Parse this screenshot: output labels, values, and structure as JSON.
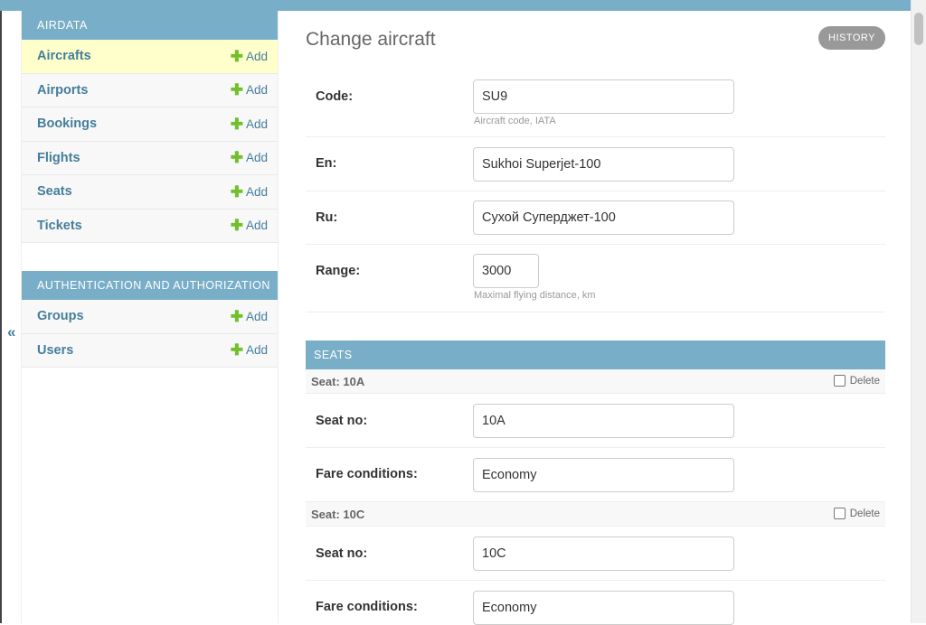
{
  "sidebar": {
    "toggle_icon": "«",
    "modules": [
      {
        "caption": "AIRDATA",
        "items": [
          {
            "label": "Aircrafts",
            "add_label": "Add"
          },
          {
            "label": "Airports",
            "add_label": "Add"
          },
          {
            "label": "Bookings",
            "add_label": "Add"
          },
          {
            "label": "Flights",
            "add_label": "Add"
          },
          {
            "label": "Seats",
            "add_label": "Add"
          },
          {
            "label": "Tickets",
            "add_label": "Add"
          }
        ]
      },
      {
        "caption": "AUTHENTICATION AND AUTHORIZATION",
        "items": [
          {
            "label": "Groups",
            "add_label": "Add"
          },
          {
            "label": "Users",
            "add_label": "Add"
          }
        ]
      }
    ]
  },
  "main": {
    "title": "Change aircraft",
    "history_label": "HISTORY",
    "fields": {
      "code": {
        "label": "Code:",
        "value": "SU9",
        "help": "Aircraft code, IATA"
      },
      "en": {
        "label": "En:",
        "value": "Sukhoi Superjet-100"
      },
      "ru": {
        "label": "Ru:",
        "value": "Сухой Суперджет-100"
      },
      "range": {
        "label": "Range:",
        "value": "3000",
        "help": "Maximal flying distance, km"
      }
    },
    "inline": {
      "caption": "SEATS",
      "delete_label": "Delete",
      "items": [
        {
          "title": "Seat: 10A",
          "seat_no_label": "Seat no:",
          "seat_no": "10A",
          "fare_label": "Fare conditions:",
          "fare": "Economy"
        },
        {
          "title": "Seat: 10C",
          "seat_no_label": "Seat no:",
          "seat_no": "10C",
          "fare_label": "Fare conditions:",
          "fare": "Economy"
        }
      ]
    }
  },
  "colors": {
    "header_bg": "#79aec8",
    "link": "#447e9b",
    "add_green": "#70bf2b",
    "selected_row": "#ffffcc"
  }
}
